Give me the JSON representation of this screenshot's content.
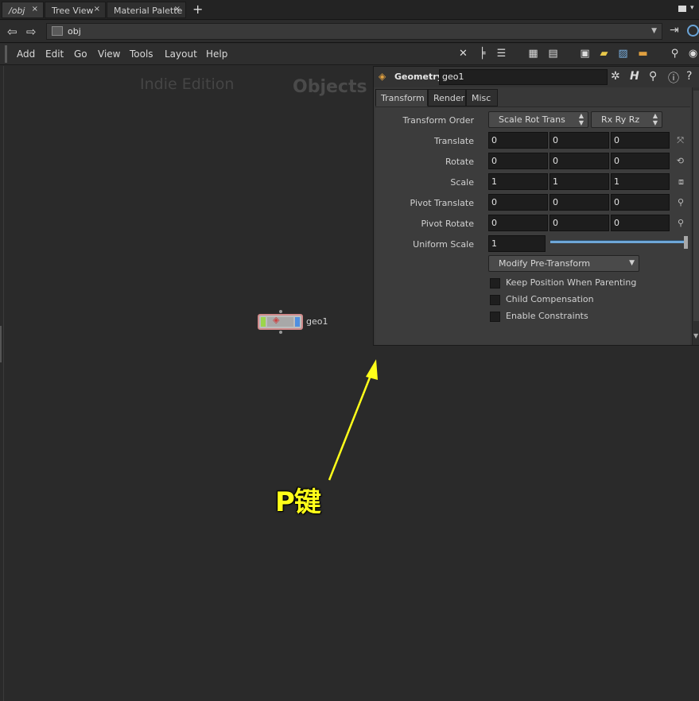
{
  "tabs": [
    {
      "label": "/obj",
      "active": true
    },
    {
      "label": "Tree View",
      "active": false
    },
    {
      "label": "Material Palette",
      "active": false
    }
  ],
  "tab_close": "×",
  "tab_add": "+",
  "path": {
    "text": "obj"
  },
  "menu": [
    "Add",
    "Edit",
    "Go",
    "View",
    "Tools",
    "Layout",
    "Help"
  ],
  "network": {
    "edition_label": "Indie Edition",
    "context_label": "Objects",
    "node_name": "geo1"
  },
  "params": {
    "node_type": "Geometry",
    "node_name": "geo1",
    "tabs": [
      "Transform",
      "Render",
      "Misc"
    ],
    "transform_order_label": "Transform Order",
    "transform_order_value": "Scale Rot Trans",
    "rotate_order_value": "Rx Ry Rz",
    "rows": [
      {
        "label": "Translate",
        "values": [
          "0",
          "0",
          "0"
        ]
      },
      {
        "label": "Rotate",
        "values": [
          "0",
          "0",
          "0"
        ]
      },
      {
        "label": "Scale",
        "values": [
          "1",
          "1",
          "1"
        ]
      },
      {
        "label": "Pivot Translate",
        "values": [
          "0",
          "0",
          "0"
        ]
      },
      {
        "label": "Pivot Rotate",
        "values": [
          "0",
          "0",
          "0"
        ]
      }
    ],
    "uniform_scale_label": "Uniform Scale",
    "uniform_scale_value": "1",
    "pre_transform_menu": "Modify Pre-Transform",
    "checkboxes": [
      "Keep Position When Parenting",
      "Child Compensation",
      "Enable Constraints"
    ]
  },
  "annotation": {
    "text": "P键",
    "color": "#ffff1a"
  }
}
